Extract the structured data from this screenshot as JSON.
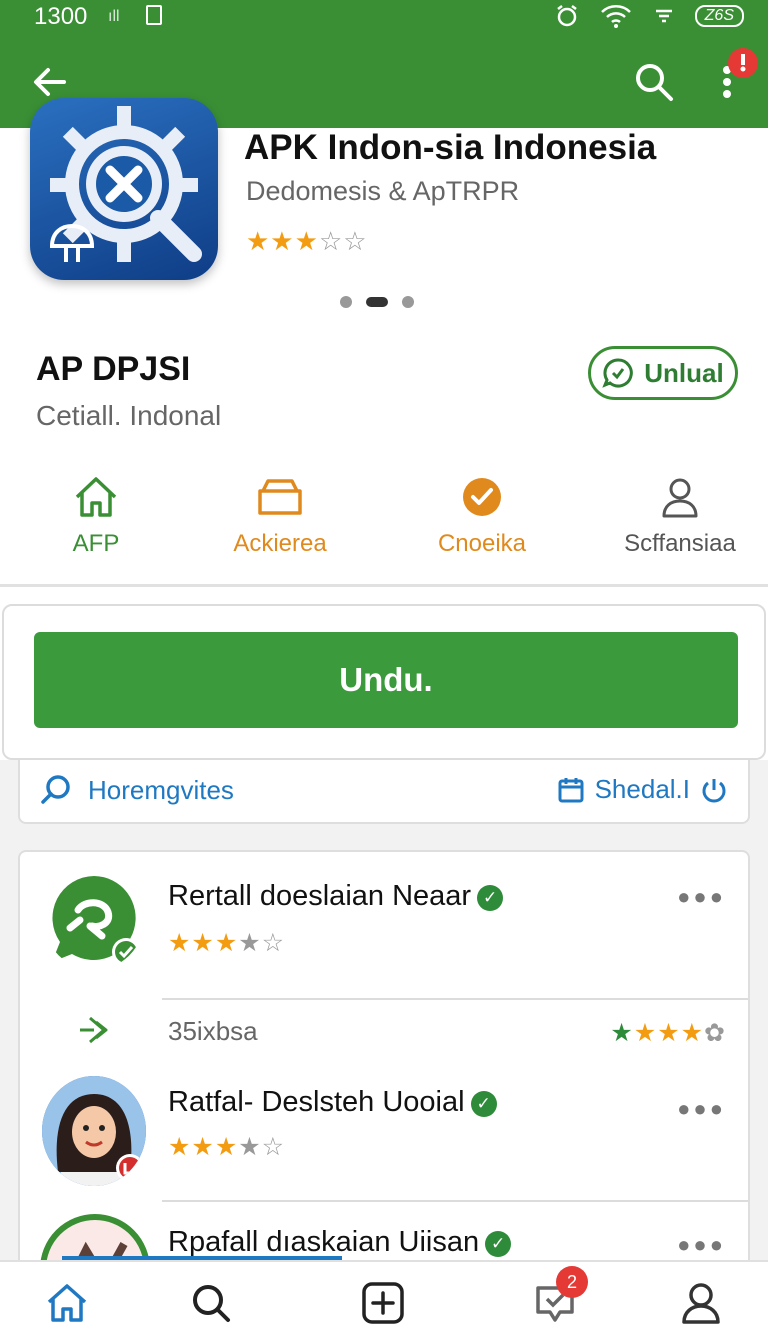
{
  "status_bar": {
    "time": "1300",
    "signal": "ıll",
    "battery": "Z6S"
  },
  "hero": {
    "title": "APK Indon-sia Indonesia",
    "subtitle": "Dedomesis & ApTRPR",
    "rating_stars": 3,
    "rating_display": "★★★☆☆"
  },
  "app": {
    "name": "AP DPJSI",
    "developer": "Cetiall. Indonal",
    "action_label": "Unlual"
  },
  "tabs": [
    {
      "label": "AFP",
      "color": "#3a8f35",
      "icon": "home-icon"
    },
    {
      "label": "Ackierea",
      "color": "#e08a1e",
      "icon": "folder-icon"
    },
    {
      "label": "Cnoeika",
      "color": "#e08a1e",
      "icon": "check-circle-icon"
    },
    {
      "label": "Scffansiaa",
      "color": "#555555",
      "icon": "person-icon"
    }
  ],
  "download_button": "Undu.",
  "filter": {
    "left_label": "Horemgvites",
    "right_label": "Shedal.I"
  },
  "list": [
    {
      "title": "Rertall doeslaian Neaar",
      "stars": "★★★★☆"
    },
    {
      "meta": "35ixbsa",
      "meta_stars": "★★★★☆"
    },
    {
      "title": "Ratfal- Deslsteh Uooial",
      "stars": "★★★★☆"
    },
    {
      "title": "Rpafall dıaskaian Uiisan"
    }
  ],
  "bottom_nav": {
    "badge": "2",
    "items": [
      "home-icon",
      "search-icon",
      "add-icon",
      "inbox-icon",
      "profile-icon"
    ]
  },
  "colors": {
    "primary_green": "#3a8f35",
    "accent_orange": "#f39c12",
    "link_blue": "#1f78c2",
    "badge_red": "#e53935"
  }
}
